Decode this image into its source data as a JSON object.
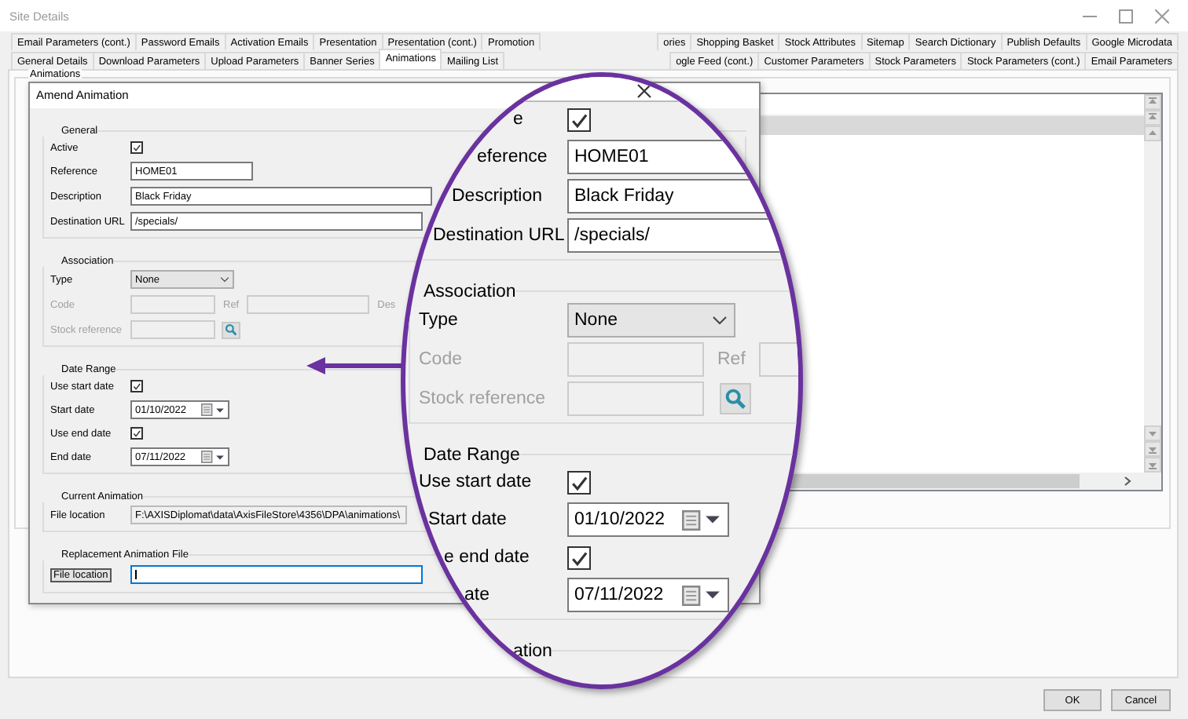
{
  "window": {
    "title": "Site Details"
  },
  "tab_rows": [
    {
      "left": [
        {
          "label": "Email Parameters (cont.)",
          "selected": false
        },
        {
          "label": "Password Emails",
          "selected": false
        },
        {
          "label": "Activation Emails",
          "selected": false
        },
        {
          "label": "Presentation",
          "selected": false
        },
        {
          "label": "Presentation (cont.)",
          "selected": false
        },
        {
          "label": "Promotion",
          "selected": false
        }
      ],
      "right": [
        {
          "label": "ories",
          "selected": false
        },
        {
          "label": "Shopping Basket",
          "selected": false
        },
        {
          "label": "Stock Attributes",
          "selected": false
        },
        {
          "label": "Sitemap",
          "selected": false
        },
        {
          "label": "Search Dictionary",
          "selected": false
        },
        {
          "label": "Publish Defaults",
          "selected": false
        },
        {
          "label": "Google Microdata",
          "selected": false
        }
      ]
    },
    {
      "left": [
        {
          "label": "General Details",
          "selected": false
        },
        {
          "label": "Download Parameters",
          "selected": false
        },
        {
          "label": "Upload Parameters",
          "selected": false
        },
        {
          "label": "Banner Series",
          "selected": false
        },
        {
          "label": "Animations",
          "selected": true
        },
        {
          "label": "Mailing List",
          "selected": false
        }
      ],
      "right": [
        {
          "label": "ogle Feed (cont.)",
          "selected": false
        },
        {
          "label": "Customer Parameters",
          "selected": false
        },
        {
          "label": "Stock Parameters",
          "selected": false
        },
        {
          "label": "Stock Parameters (cont.)",
          "selected": false
        },
        {
          "label": "Email Parameters",
          "selected": false
        }
      ]
    }
  ],
  "animations_group": {
    "label": "Animations"
  },
  "dialog": {
    "title": "Amend Animation",
    "general": {
      "label": "General",
      "active": {
        "label": "Active",
        "checked": true
      },
      "reference": {
        "label": "Reference",
        "value": "HOME01"
      },
      "description": {
        "label": "Description",
        "value": "Black Friday"
      },
      "destination_url": {
        "label": "Destination URL",
        "value": "/specials/"
      }
    },
    "association": {
      "label": "Association",
      "type": {
        "label": "Type",
        "value": "None"
      },
      "code": {
        "label": "Code",
        "disabled": true
      },
      "ref": {
        "label": "Ref",
        "disabled": true
      },
      "des": {
        "label": "Des",
        "disabled": true
      },
      "stock_reference": {
        "label": "Stock reference",
        "disabled": true
      }
    },
    "date_range": {
      "label": "Date Range",
      "use_start_date": {
        "label": "Use start date",
        "checked": true
      },
      "start_date": {
        "label": "Start date",
        "value": "01/10/2022"
      },
      "use_end_date": {
        "label": "Use end date",
        "checked": true
      },
      "end_date": {
        "label": "End date",
        "value": "07/11/2022"
      }
    },
    "current_animation": {
      "label": "Current Animation",
      "file_location": {
        "label": "File location",
        "value": "F:\\AXISDiplomat\\data\\AxisFileStore\\4356\\DPA\\animations\\"
      }
    },
    "replacement": {
      "label": "Replacement Animation File",
      "file_location": {
        "label": "File location",
        "label_focused": true,
        "focused": true
      }
    }
  },
  "magnifier": {
    "general": {
      "active": {
        "label": "e",
        "checked": true
      },
      "reference": {
        "label": "eference",
        "value": "HOME01"
      },
      "description": {
        "label": "Description",
        "value": "Black Friday"
      },
      "destination_url": {
        "label": "Destination URL",
        "value": "/specials/"
      }
    },
    "association": {
      "label": "Association",
      "type": {
        "label": "Type",
        "value": "None"
      },
      "code": {
        "label": "Code",
        "disabled": true
      },
      "ref": {
        "label": "Ref",
        "disabled": true
      },
      "stock_reference": {
        "label": "Stock reference",
        "disabled": true
      }
    },
    "date_range": {
      "label": "Date Range",
      "use_start_date": {
        "label": "Use start date",
        "checked": true
      },
      "start_date": {
        "label": "Start date",
        "value": "01/10/2022"
      },
      "use_end_date": {
        "label": "e end date",
        "checked": true
      },
      "end_date": {
        "label": "ate",
        "value": "07/11/2022"
      }
    },
    "current_animation": {
      "label": "ation"
    }
  },
  "buttons": [
    {
      "label": "OK"
    },
    {
      "label": "Cancel"
    }
  ]
}
